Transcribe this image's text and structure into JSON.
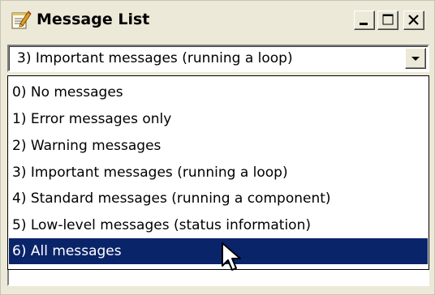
{
  "window": {
    "title": "Message List",
    "app_icon": "edit-notepad-icon",
    "controls": {
      "minimize_icon": "minimize-icon",
      "maximize_icon": "maximize-icon",
      "close_icon": "close-icon"
    }
  },
  "combo": {
    "selected_value": "3) Important messages (running a loop)",
    "dropdown_icon": "chevron-down-icon"
  },
  "dropdown": {
    "options": [
      {
        "label": "0) No messages"
      },
      {
        "label": "1) Error messages only"
      },
      {
        "label": "2) Warning messages"
      },
      {
        "label": "3) Important messages (running a loop)"
      },
      {
        "label": "4) Standard messages (running a component)"
      },
      {
        "label": "5) Low-level messages (status information)"
      },
      {
        "label": "6) All messages"
      }
    ],
    "highlighted_label": "6) All messages"
  },
  "colors": {
    "window_bg": "#ece9d8",
    "selection_bg": "#0a246a",
    "selection_fg": "#ffffff"
  },
  "cursor_icon": "mouse-pointer-icon"
}
